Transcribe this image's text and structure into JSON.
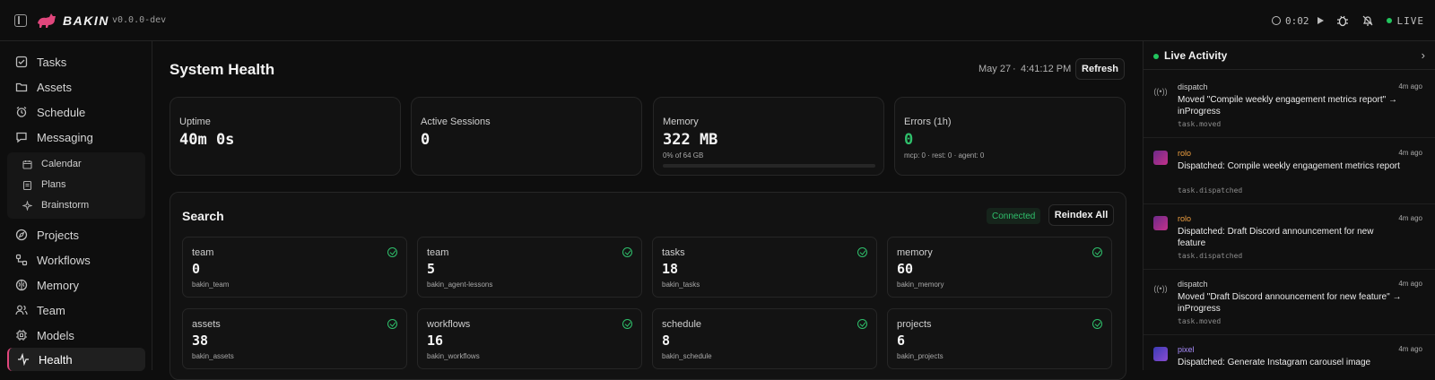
{
  "app": {
    "brand": "BAKIN",
    "version": "v0.0.0-dev",
    "timer": "0:02",
    "live_label": "LIVE"
  },
  "sidebar": {
    "items": [
      {
        "label": "Tasks",
        "icon": "checkbox-icon"
      },
      {
        "label": "Assets",
        "icon": "folder-icon"
      },
      {
        "label": "Schedule",
        "icon": "alarm-clock-icon"
      },
      {
        "label": "Messaging",
        "icon": "message-icon"
      }
    ],
    "sub_items": [
      {
        "label": "Calendar",
        "icon": "calendar-icon"
      },
      {
        "label": "Plans",
        "icon": "clipboard-icon"
      },
      {
        "label": "Brainstorm",
        "icon": "sparkle-icon"
      }
    ],
    "items2": [
      {
        "label": "Projects",
        "icon": "compass-icon"
      },
      {
        "label": "Workflows",
        "icon": "workflow-icon"
      },
      {
        "label": "Memory",
        "icon": "brain-icon"
      },
      {
        "label": "Team",
        "icon": "users-icon"
      },
      {
        "label": "Models",
        "icon": "cpu-icon"
      },
      {
        "label": "Health",
        "icon": "activity-icon"
      }
    ]
  },
  "main": {
    "title": "System Health",
    "date": "May 27",
    "time": "4:41:12 PM",
    "refresh_label": "Refresh",
    "stats": [
      {
        "label": "Uptime",
        "value": "40m 0s",
        "sub": ""
      },
      {
        "label": "Active Sessions",
        "value": "0",
        "sub": ""
      },
      {
        "label": "Memory",
        "value": "322 MB",
        "sub": "0% of 64 GB",
        "progress": 0
      },
      {
        "label": "Errors (1h)",
        "value": "0",
        "sub": "mcp: 0 · rest: 0 · agent: 0"
      }
    ],
    "search": {
      "title": "Search",
      "status": "Connected",
      "reindex_label": "Reindex All",
      "indexes": [
        {
          "label": "team",
          "count": "0",
          "name": "bakin_team"
        },
        {
          "label": "team",
          "count": "5",
          "name": "bakin_agent-lessons"
        },
        {
          "label": "tasks",
          "count": "18",
          "name": "bakin_tasks"
        },
        {
          "label": "memory",
          "count": "60",
          "name": "bakin_memory"
        },
        {
          "label": "assets",
          "count": "38",
          "name": "bakin_assets"
        },
        {
          "label": "workflows",
          "count": "16",
          "name": "bakin_workflows"
        },
        {
          "label": "schedule",
          "count": "8",
          "name": "bakin_schedule"
        },
        {
          "label": "projects",
          "count": "6",
          "name": "bakin_projects"
        }
      ]
    }
  },
  "activity": {
    "title": "Live Activity",
    "events": [
      {
        "actor": "dispatch",
        "time": "4m ago",
        "message": "Moved \"Compile weekly engagement metrics report\" → inProgress",
        "type": "task.moved",
        "actor_color": "#cfcfcf"
      },
      {
        "actor": "rolo",
        "time": "4m ago",
        "message": "Dispatched: Compile weekly engagement metrics report",
        "type": "task.dispatched",
        "actor_color": "#f0a040"
      },
      {
        "actor": "rolo",
        "time": "4m ago",
        "message": "Dispatched: Draft Discord announcement for new feature",
        "type": "task.dispatched",
        "actor_color": "#f0a040"
      },
      {
        "actor": "dispatch",
        "time": "4m ago",
        "message": "Moved \"Draft Discord announcement for new feature\" → inProgress",
        "type": "task.moved",
        "actor_color": "#cfcfcf"
      },
      {
        "actor": "pixel",
        "time": "4m ago",
        "message": "Dispatched: Generate Instagram carousel image",
        "type": "",
        "actor_color": "#a78bfa"
      }
    ]
  },
  "colors": {
    "accent": "#e0467c",
    "success": "#22c55e",
    "background": "#0e0e0e"
  }
}
